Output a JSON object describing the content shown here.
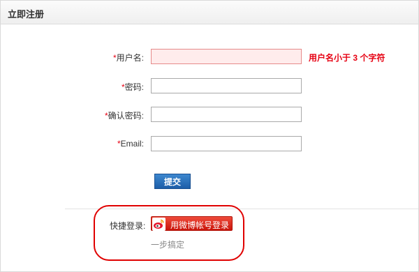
{
  "header": {
    "title": "立即注册"
  },
  "form": {
    "required_mark": "*",
    "username": {
      "label": "用户名:",
      "value": "",
      "error": "用户名小于 3 个字符"
    },
    "password": {
      "label": "密码:",
      "value": ""
    },
    "confirm_password": {
      "label": "确认密码:",
      "value": ""
    },
    "email": {
      "label": "Email:",
      "value": ""
    },
    "submit_label": "提交"
  },
  "quick_login": {
    "label": "快捷登录:",
    "weibo_label": "用微博帐号登录",
    "note": "一步搞定"
  },
  "colors": {
    "required": "#e60012",
    "error_field_bg": "#ffecec",
    "submit_bg": "#1d5ea8",
    "weibo_bg": "#d7261b",
    "highlight_outline": "#e00000"
  }
}
